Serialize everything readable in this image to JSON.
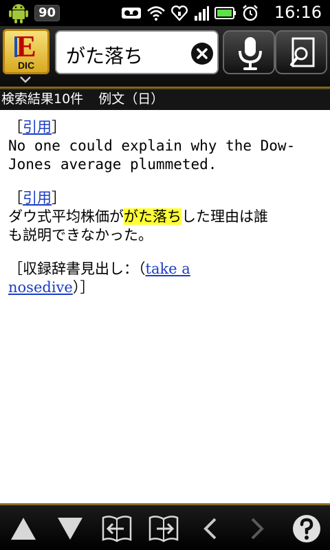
{
  "status_bar": {
    "badge": "90",
    "time": "16:16"
  },
  "header": {
    "logo_letter": "E",
    "logo_sub": "DIC",
    "search_value": "がた落ち"
  },
  "result_bar": {
    "count_label": "検索結果10件",
    "mode_label": "例文（日）"
  },
  "content": {
    "en_entry": {
      "bracket_open": "［",
      "link": "引用",
      "bracket_close": "］",
      "line1": "No one could explain why the Dow-",
      "line2": "Jones average plummeted."
    },
    "ja_entry": {
      "bracket_open": "［",
      "link": "引用",
      "bracket_close": "］",
      "pre": "ダウ式平均株価が",
      "highlight": "がた落ち",
      "post": "した理由は誰",
      "line2": "も説明できなかった。"
    },
    "source": {
      "prefix": "［収録辞書見出し：（",
      "link_part1": "take a",
      "link_part2": "nosedive",
      "suffix": "）］"
    }
  },
  "colors": {
    "link": "#1a3cc4",
    "highlight": "#ffff33",
    "toolbar_accent": "#8b6d1f"
  },
  "icons": {
    "status": [
      "android-icon",
      "voicemail-icon",
      "wifi-icon",
      "heart-sync-icon",
      "signal-icon",
      "battery-icon",
      "alarm-icon"
    ],
    "toolbar": [
      "arrow-up-icon",
      "arrow-down-icon",
      "book-prev-icon",
      "book-next-icon",
      "chevron-left-icon",
      "chevron-right-icon",
      "help-icon"
    ]
  }
}
